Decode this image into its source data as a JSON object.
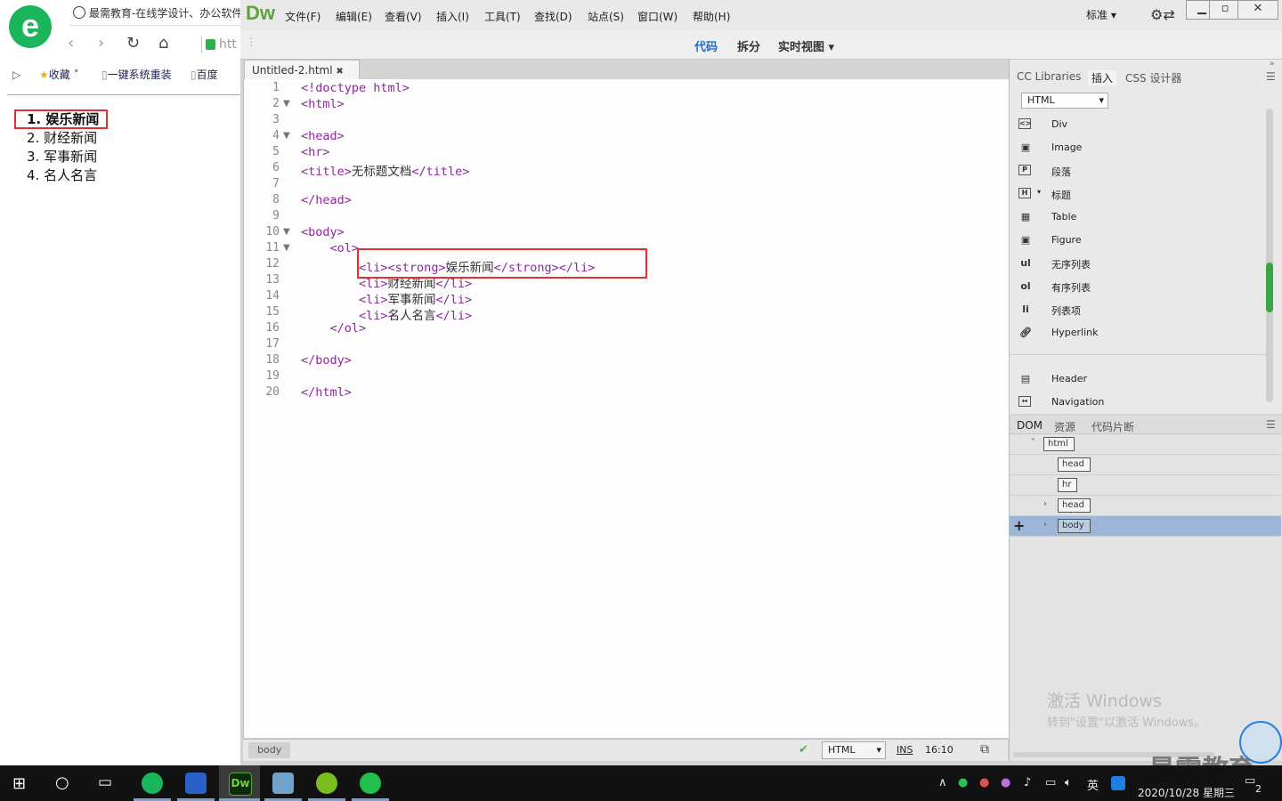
{
  "browser": {
    "tab_title": "最需教育-在线学设计、办公软件",
    "url": "htt",
    "bookmarks": [
      "收藏",
      "一键系统重装",
      "百度"
    ],
    "list": [
      "1. 娱乐新闻",
      "2. 财经新闻",
      "3. 军事新闻",
      "4. 名人名言"
    ]
  },
  "dw": {
    "logo": "Dw",
    "menus": [
      "文件(F)",
      "编辑(E)",
      "查看(V)",
      "插入(I)",
      "工具(T)",
      "查找(D)",
      "站点(S)",
      "窗口(W)",
      "帮助(H)"
    ],
    "workspace": "标准",
    "views": [
      "代码",
      "拆分",
      "实时视图"
    ],
    "doc_tab": "Untitled-2.html",
    "code_lines": [
      {
        "n": "1",
        "t": "<!doctype html>"
      },
      {
        "n": "2",
        "t": "<html>"
      },
      {
        "n": "3",
        "t": ""
      },
      {
        "n": "4",
        "t": "<head>"
      },
      {
        "n": "5",
        "t": "<hr>"
      },
      {
        "n": "6",
        "t": "<title>无标题文档</title>"
      },
      {
        "n": "7",
        "t": ""
      },
      {
        "n": "8",
        "t": "</head>"
      },
      {
        "n": "9",
        "t": ""
      },
      {
        "n": "10",
        "t": "<body>"
      },
      {
        "n": "11",
        "t": "    <ol>"
      },
      {
        "n": "12",
        "t": "        <li><strong>娱乐新闻</strong></li>"
      },
      {
        "n": "13",
        "t": "        <li>财经新闻</li>"
      },
      {
        "n": "14",
        "t": "        <li>军事新闻</li>"
      },
      {
        "n": "15",
        "t": "        <li>名人名言</li>"
      },
      {
        "n": "16",
        "t": "    </ol>"
      },
      {
        "n": "17",
        "t": ""
      },
      {
        "n": "18",
        "t": "</body>"
      },
      {
        "n": "19",
        "t": ""
      },
      {
        "n": "20",
        "t": "</html>"
      }
    ],
    "status": {
      "crumb": "body",
      "lang": "HTML",
      "mode": "INS",
      "pos": "16:10"
    },
    "insert_panel": {
      "tabs": [
        "CC Libraries",
        "插入",
        "CSS 设计器"
      ],
      "category": "HTML",
      "items": [
        {
          "icon": "div-icon",
          "label": "Div"
        },
        {
          "icon": "image-icon",
          "label": "Image"
        },
        {
          "icon": "paragraph-icon",
          "label": "段落"
        },
        {
          "icon": "heading-icon",
          "label": "标题"
        },
        {
          "icon": "table-icon",
          "label": "Table"
        },
        {
          "icon": "figure-icon",
          "label": "Figure"
        },
        {
          "icon": "ul-icon",
          "label": "无序列表"
        },
        {
          "icon": "ol-icon",
          "label": "有序列表"
        },
        {
          "icon": "li-icon",
          "label": "列表项"
        },
        {
          "icon": "hyperlink-icon",
          "label": "Hyperlink"
        },
        {
          "icon": "header-icon",
          "label": "Header"
        },
        {
          "icon": "navigation-icon",
          "label": "Navigation"
        }
      ],
      "icon_text": {
        "ul": "ul",
        "ol": "ol",
        "li": "li"
      }
    },
    "dom_panel": {
      "tabs": [
        "DOM",
        "资源",
        "代码片断"
      ],
      "nodes": [
        "html",
        "head",
        "hr",
        "head",
        "body"
      ]
    },
    "watermark": [
      "激活 Windows",
      "转到\"设置\"以激活 Windows。"
    ],
    "brand_watermark": "最需教育"
  },
  "taskbar": {
    "ime": "英",
    "datetime": "2020/10/28 星期三",
    "notif_count": "2"
  },
  "colors": {
    "highlight": "#e03030",
    "tag": "#8a2b9a",
    "dw_green": "#5ea33b",
    "dom_selected": "#9bb6d6"
  }
}
